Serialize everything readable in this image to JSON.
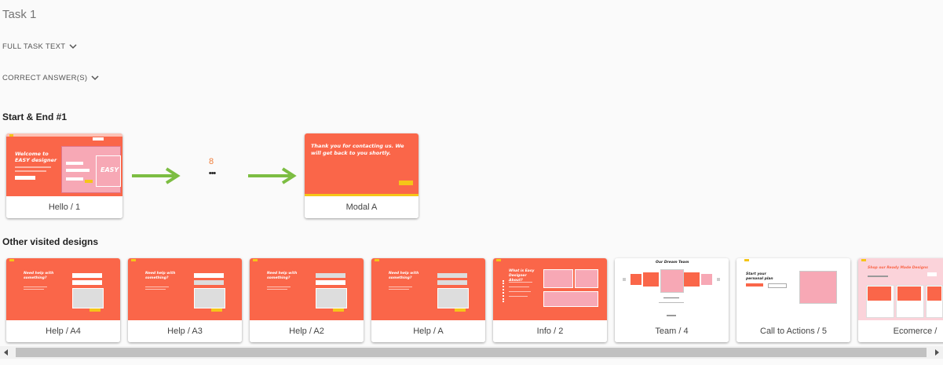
{
  "task": {
    "title": "Task 1"
  },
  "toggles": {
    "full_text": "FULL TASK TEXT",
    "correct_answers": "CORRECT ANSWER(S)"
  },
  "start_end": {
    "title": "Start & End #1",
    "start_card": {
      "label": "Hello / 1",
      "thumb": {
        "heading": "Welcome to EASY designer",
        "logo": "EASY"
      }
    },
    "steps": {
      "count": "8",
      "dots": "•••"
    },
    "end_card": {
      "label": "Modal A",
      "thumb": {
        "heading": "Thank you for contacting us. We will get back to you shortly."
      }
    }
  },
  "other": {
    "title": "Other visited designs",
    "cards": [
      {
        "label": "Help / A4",
        "heading": "Need help with something?"
      },
      {
        "label": "Help / A3",
        "heading": "Need help with something?"
      },
      {
        "label": "Help / A2",
        "heading": "Need help with something?"
      },
      {
        "label": "Help / A",
        "heading": "Need help with something?"
      },
      {
        "label": "Info / 2",
        "heading": "What is Easy Designer About?"
      },
      {
        "label": "Team / 4",
        "heading": "Our Dream Team"
      },
      {
        "label": "Call to Actions / 5",
        "heading": "Start your personal plan"
      },
      {
        "label": "Ecomerce /",
        "heading": "Shop our Ready Made Designs"
      }
    ]
  },
  "colors": {
    "accent": "#fa6649",
    "pink": "#f7a8b5",
    "arrow": "#7cbd42",
    "count": "#f07f3c",
    "yellow": "#f5c518"
  }
}
